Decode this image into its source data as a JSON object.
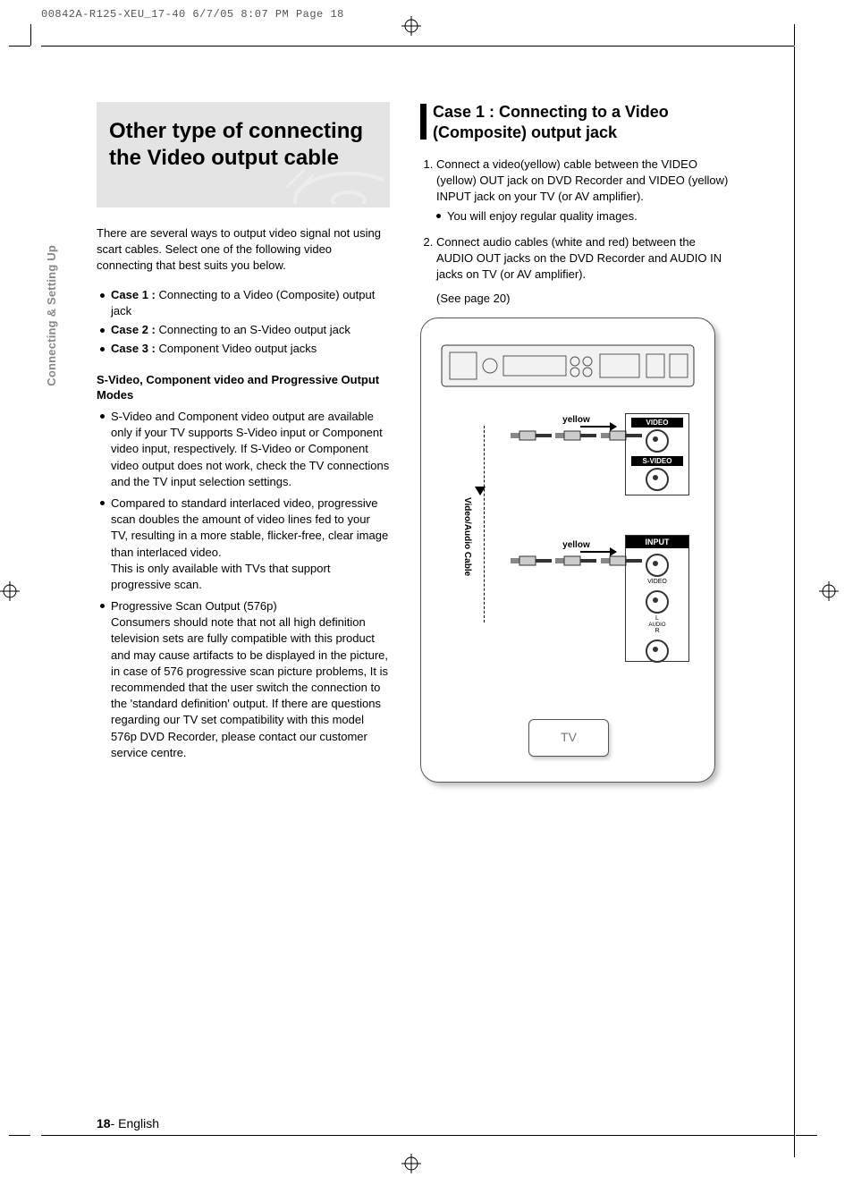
{
  "print_header": "00842A-R125-XEU_17-40  6/7/05  8:07 PM  Page 18",
  "side_tab": "Connecting & Setting Up",
  "title": "Other type of connecting the Video output cable",
  "intro": "There are several ways to output video signal not using scart cables. Select one of the following video connecting that best suits you below.",
  "cases": [
    {
      "label": "Case 1 :",
      "text": " Connecting to a Video (Composite) output jack"
    },
    {
      "label": "Case 2 :",
      "text": " Connecting to an S-Video output jack"
    },
    {
      "label": "Case 3 :",
      "text": " Component Video output jacks"
    }
  ],
  "sub_heading": "S-Video, Component video and Progressive Output Modes",
  "bullets": [
    "S-Video and Component video output are available only if your TV supports S-Video input or Component video input, respectively. If S-Video or Component video output does not work, check the TV connections and the TV input selection settings.",
    "Compared to standard interlaced video, progressive scan doubles the amount of video lines fed to your TV, resulting in a more stable, flicker-free, clear image than interlaced video.\n This is only available with TVs that support progressive scan.",
    "Progressive Scan Output (576p)\nConsumers should note that not all high definition television sets are fully compatible with this product and may cause artifacts to be displayed in the picture, in case of 576 progressive scan picture problems, It is recommended that the user switch the connection to the 'standard definition' output. If there are questions regarding our TV set compatibility with this model 576p DVD Recorder, please contact our customer service centre."
  ],
  "section_title": "Case 1 : Connecting to a Video (Composite) output jack",
  "steps": [
    {
      "text": "Connect a video(yellow) cable between the VIDEO (yellow) OUT jack on DVD Recorder and VIDEO (yellow) INPUT jack on your TV (or AV amplifier).",
      "sub": "You will enjoy regular quality images."
    },
    {
      "text": "Connect audio cables (white and red) between the AUDIO OUT jacks on the DVD Recorder and AUDIO IN jacks on TV (or AV amplifier)."
    }
  ],
  "see_page": "(See page 20)",
  "diagram": {
    "yellow": "yellow",
    "cable_label": "Video/Audio Cable",
    "out_video": "VIDEO",
    "out_svideo": "S-VIDEO",
    "input": "INPUT",
    "in_video": "VIDEO",
    "in_audio_l": "L",
    "in_audio": "AUDIO",
    "in_audio_r": "R",
    "tv": "TV"
  },
  "footer": {
    "page": "18",
    "sep": "- ",
    "lang": "English"
  }
}
